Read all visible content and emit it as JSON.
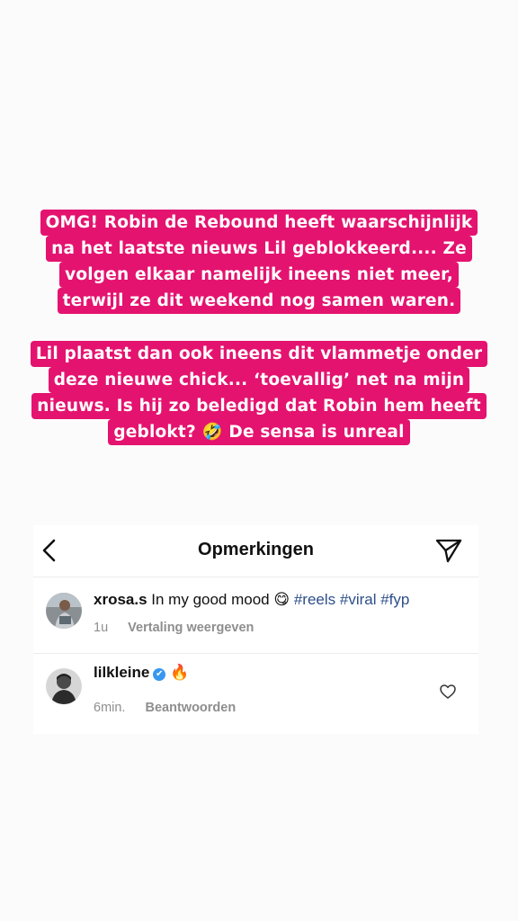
{
  "story": {
    "paragraph1": [
      "OMG! Robin de Rebound heeft waarschijnlijk",
      "na het laatste nieuws Lil geblokkeerd.... Ze",
      "volgen elkaar namelijk ineens niet meer,",
      "terwijl ze dit weekend nog samen waren."
    ],
    "paragraph2": [
      "Lil plaatst dan ook ineens dit vlammetje onder",
      "deze nieuwe chick... ‘toevallig’ net na mijn",
      "nieuws. Is hij zo beledigd dat Robin hem heeft",
      "geblokt? 🤣  De sensa is unreal"
    ]
  },
  "comments": {
    "title": "Opmerkingen",
    "back_icon": "chevron-left-icon",
    "share_icon": "paper-plane-icon",
    "caption_comment": {
      "username": "xrosa.s",
      "text": "In my good mood",
      "emoji": "😋",
      "hashtags": "#reels #viral #fyp",
      "time": "1u",
      "action": "Vertaling weergeven"
    },
    "reply": {
      "username": "lilkleine",
      "verified": "✔",
      "emoji": "🔥",
      "time": "6min.",
      "action": "Beantwoorden",
      "like_icon": "heart-outline-icon"
    }
  },
  "colors": {
    "highlight": "#e4136f",
    "hashtag": "#2d4e8a",
    "verified": "#3897f0"
  }
}
